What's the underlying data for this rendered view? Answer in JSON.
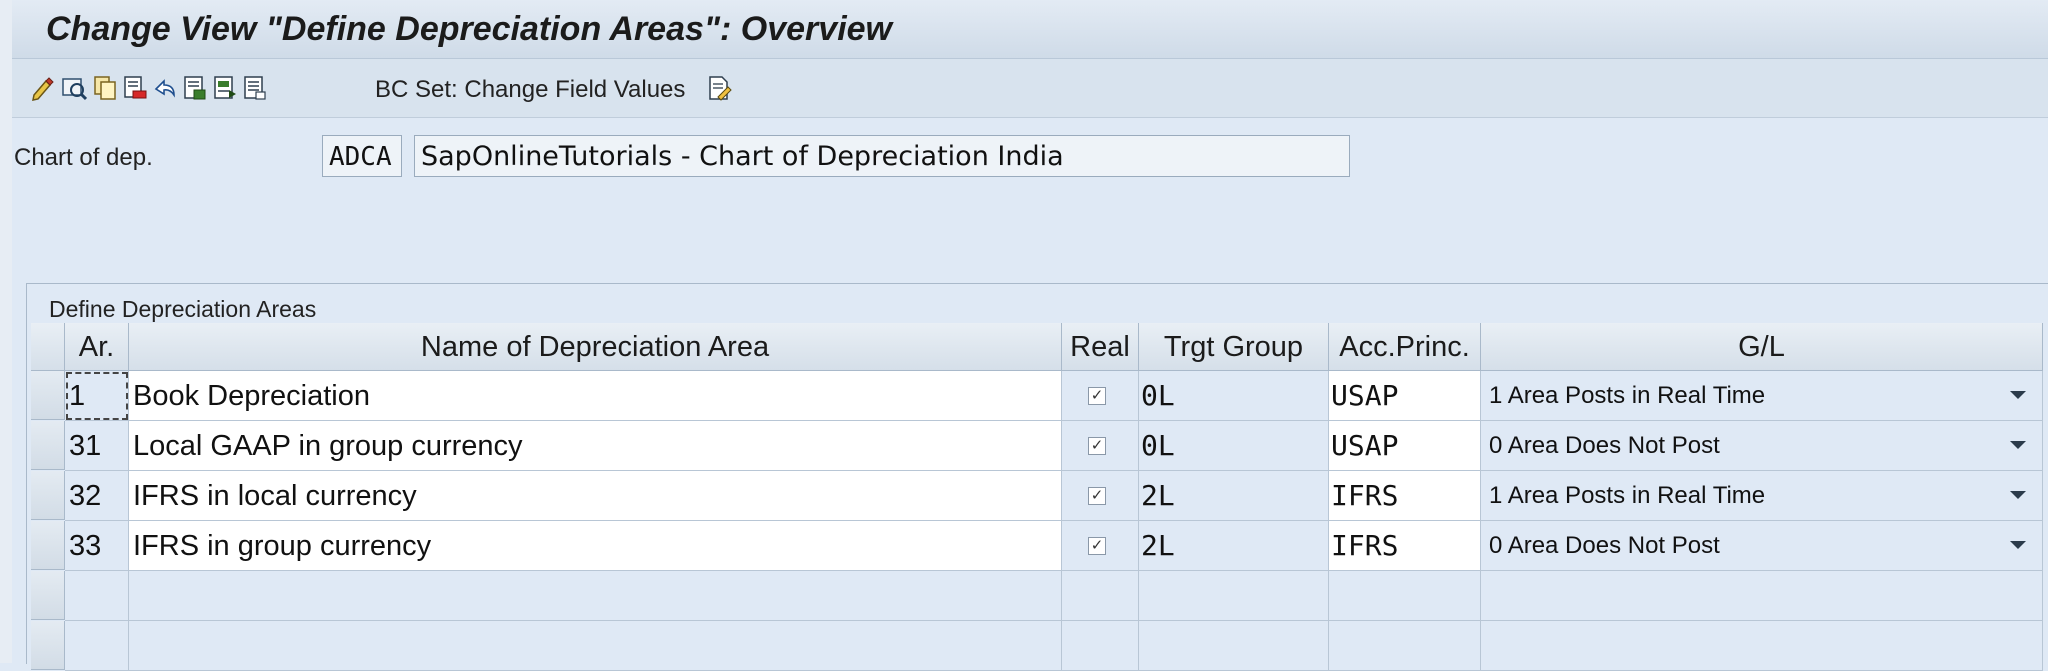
{
  "title": "Change View \"Define Depreciation Areas\": Overview",
  "toolbar": {
    "icons": [
      "edit-icon",
      "display-change-icon",
      "copy-icon",
      "delete-icon",
      "undo-icon",
      "select-all-icon",
      "select-block-icon",
      "deselect-all-icon"
    ],
    "bc_set_label": "BC Set: Change Field Values",
    "bc_set_icon": "bc-set-document-icon"
  },
  "chart": {
    "label": "Chart of dep.",
    "code": "ADCA",
    "description": "SapOnlineTutorials - Chart of Depreciation India"
  },
  "table": {
    "title": "Define Depreciation Areas",
    "headers": {
      "ar": "Ar.",
      "name": "Name of Depreciation Area",
      "real": "Real",
      "trgt_group": "Trgt Group",
      "acc_princ": "Acc.Princ.",
      "gl": "G/L"
    },
    "rows": [
      {
        "ar": "1",
        "name": "Book Depreciation",
        "real": "✓",
        "trgt_group": "0L",
        "acc_princ": "USAP",
        "gl": "1  Area Posts in Real Time"
      },
      {
        "ar": "31",
        "name": "Local GAAP in group currency",
        "real": "✓",
        "trgt_group": "0L",
        "acc_princ": "USAP",
        "gl": "0  Area Does Not Post"
      },
      {
        "ar": "32",
        "name": "IFRS in local currency",
        "real": "✓",
        "trgt_group": "2L",
        "acc_princ": "IFRS",
        "gl": "1  Area Posts in Real Time"
      },
      {
        "ar": "33",
        "name": "IFRS in group currency",
        "real": "✓",
        "trgt_group": "2L",
        "acc_princ": "IFRS",
        "gl": "0  Area Does Not Post"
      }
    ]
  },
  "colors": {
    "background": "#dfe9f5",
    "cell_white": "#ffffff",
    "header": "#d5dfe9"
  }
}
